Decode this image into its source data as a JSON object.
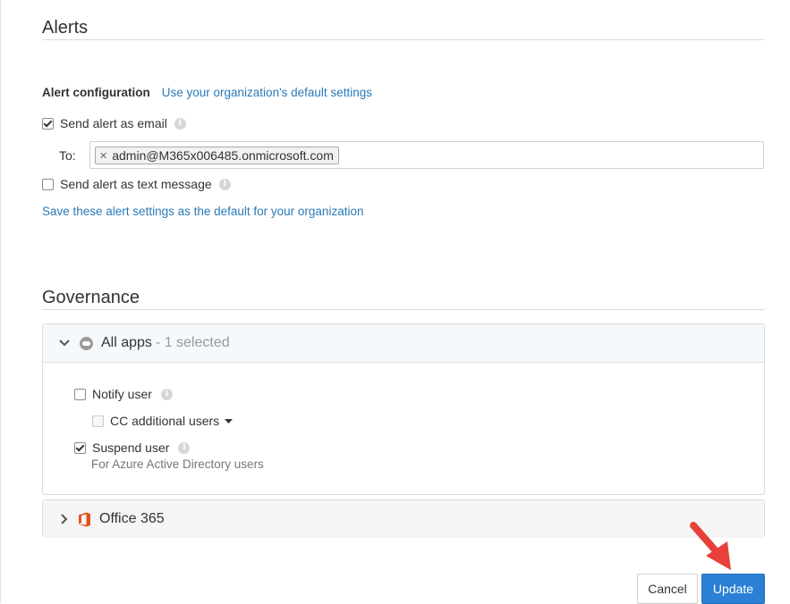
{
  "alerts": {
    "title": "Alerts",
    "config_label": "Alert configuration",
    "default_settings_link": "Use your organization's default settings",
    "send_email_label": "Send alert as email",
    "send_email_checked": true,
    "to_label": "To:",
    "recipients": [
      "admin@M365x006485.onmicrosoft.com"
    ],
    "send_text_label": "Send alert as text message",
    "send_text_checked": false,
    "save_default_link": "Save these alert settings as the default for your organization"
  },
  "governance": {
    "title": "Governance",
    "all_apps": {
      "title": "All apps",
      "subtitle": "- 1 selected",
      "expanded": true,
      "notify_user_label": "Notify user",
      "notify_user_checked": false,
      "cc_label": "CC additional users",
      "cc_checked": false,
      "suspend_user_label": "Suspend user",
      "suspend_user_checked": true,
      "suspend_user_hint": "For Azure Active Directory users"
    },
    "office365": {
      "title": "Office 365",
      "expanded": false
    }
  },
  "footer": {
    "cancel_label": "Cancel",
    "update_label": "Update"
  },
  "colors": {
    "link": "#2a7ab8",
    "primary_button": "#2b7fd4",
    "office_icon": "#e2521c",
    "annotation_arrow": "#e8403a"
  },
  "icons": {
    "info": "info-icon",
    "chevron_down": "chevron-down-icon",
    "chevron_right": "chevron-right-icon",
    "cloud": "cloud-icon",
    "office": "office365-icon",
    "remove_chip": "close-icon",
    "dropdown": "caret-down-icon",
    "annotation": "red-arrow-icon"
  }
}
